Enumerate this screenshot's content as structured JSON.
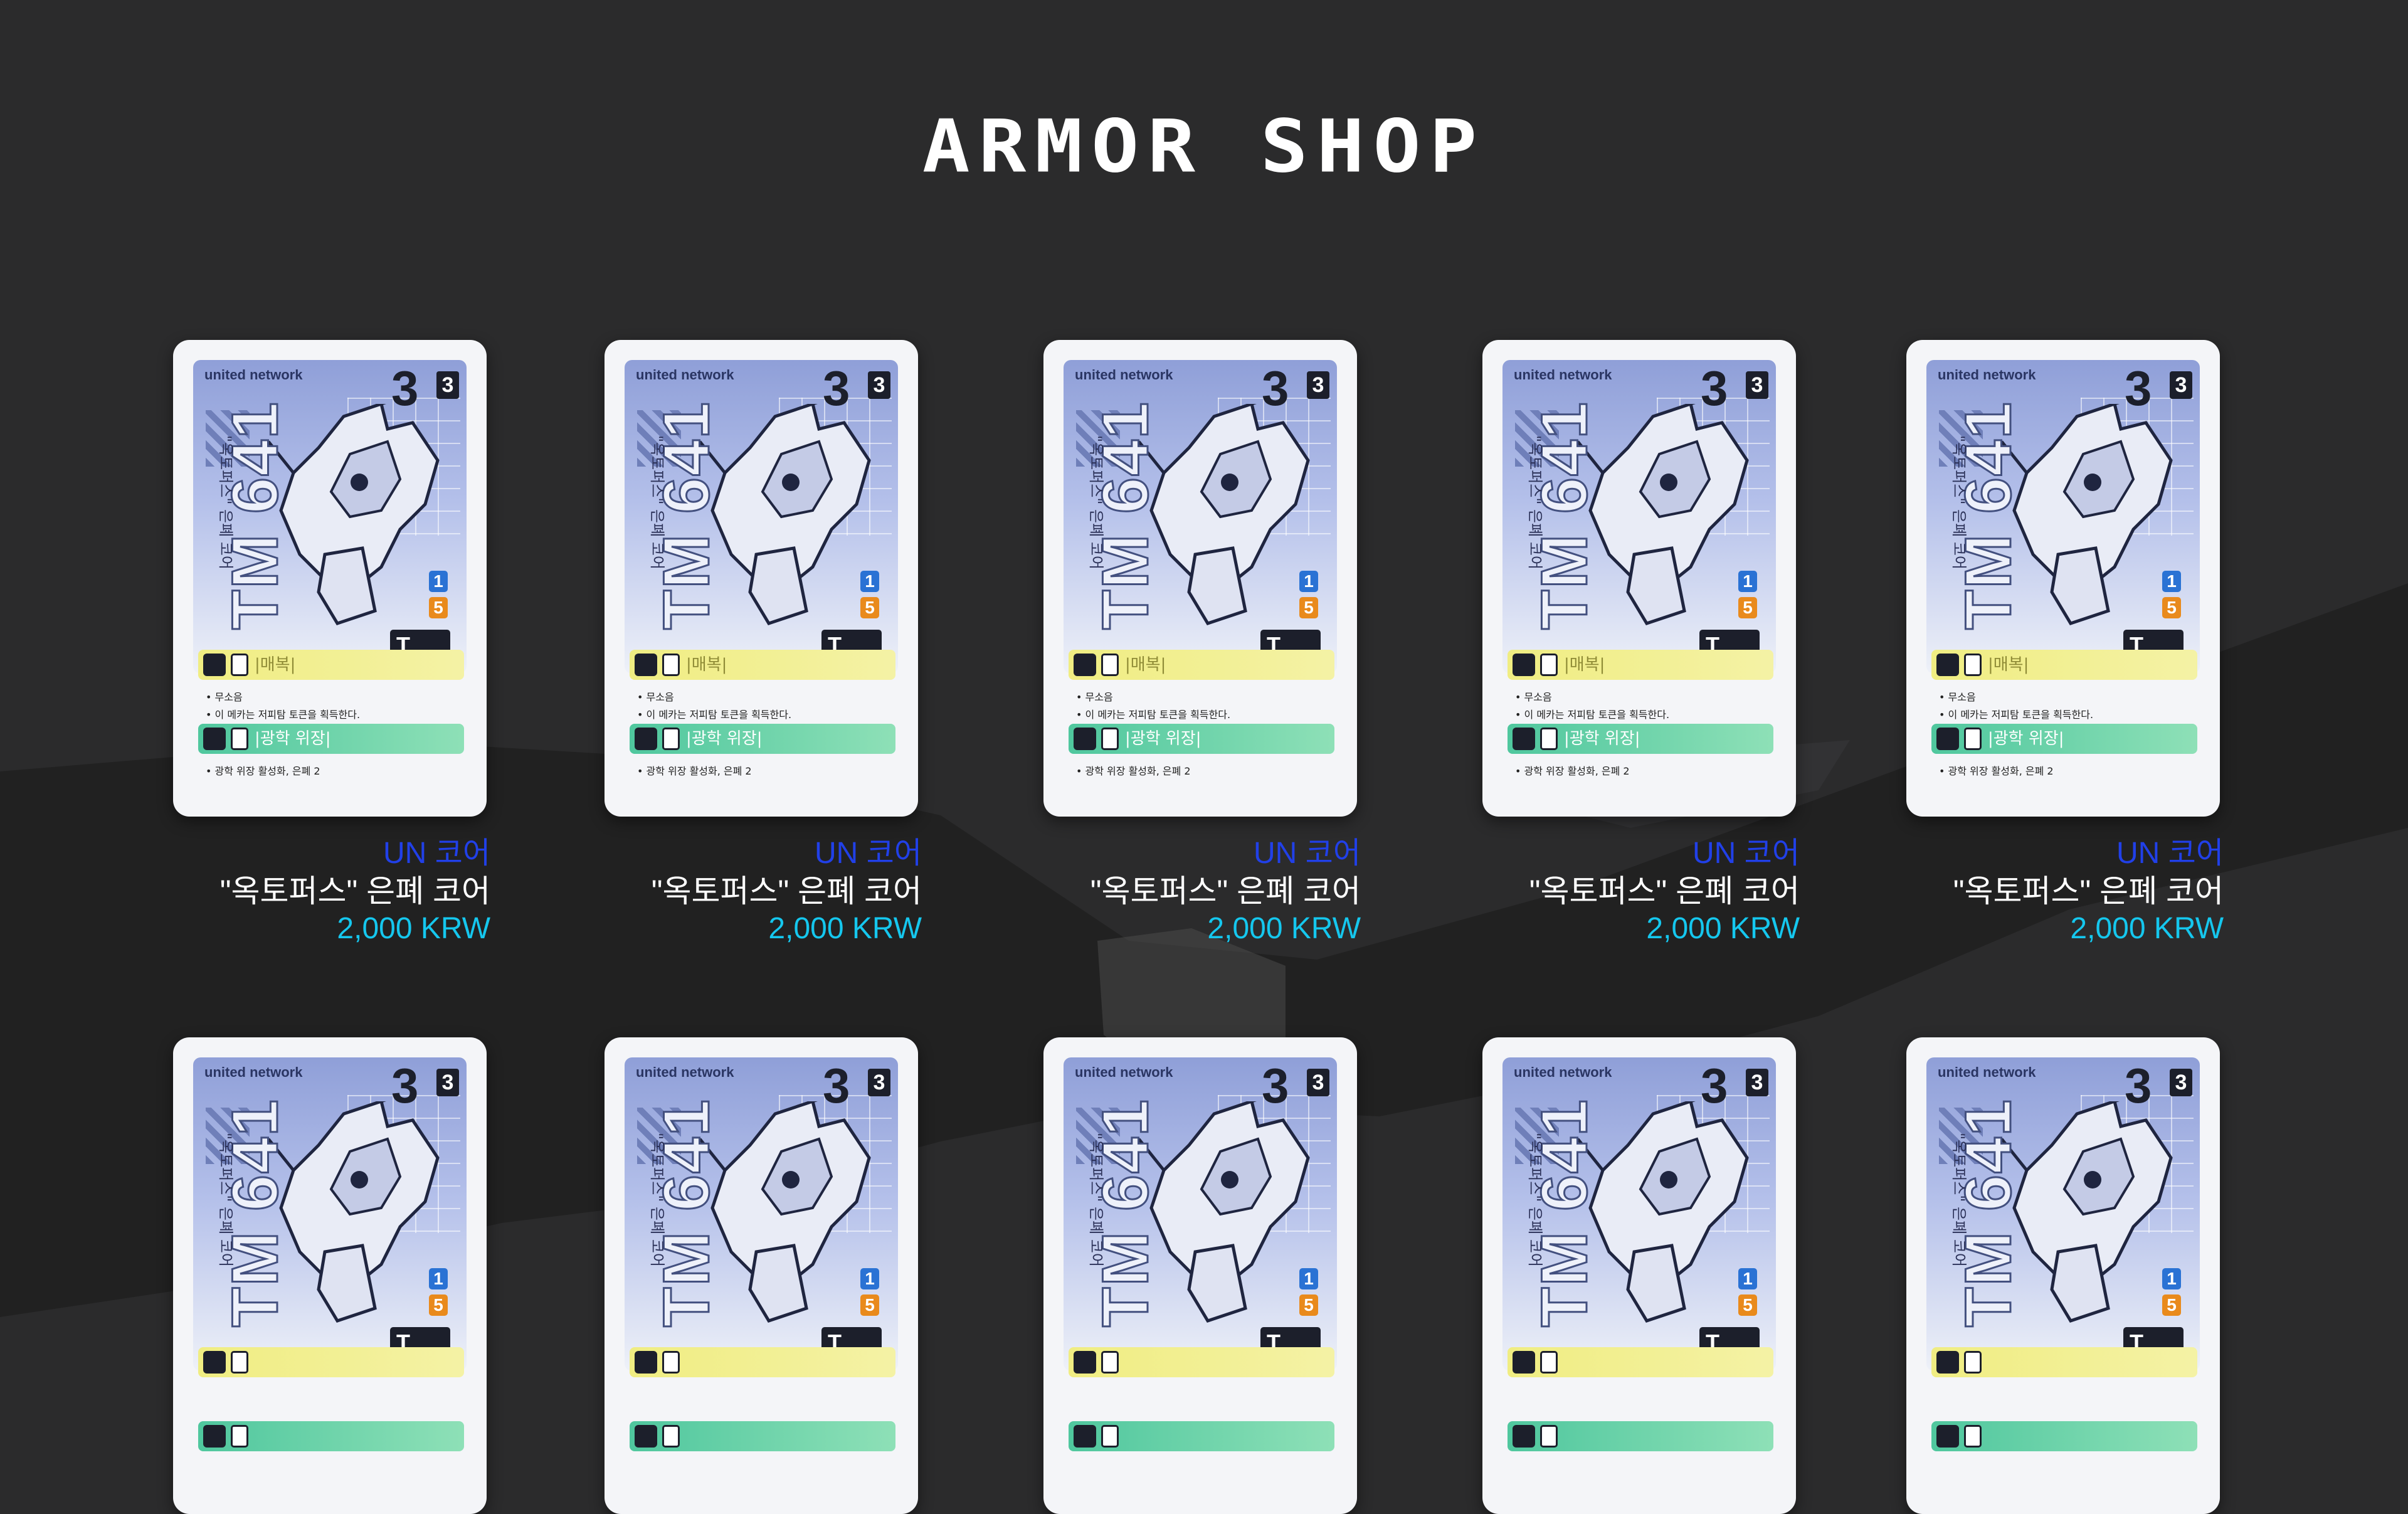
{
  "page": {
    "title": "ARMOR SHOP",
    "background_color": "#2b2b2c",
    "title_color": "#ffffff"
  },
  "colors": {
    "brand": "#2140e8",
    "name": "#ffffff",
    "price": "#15c7ee"
  },
  "products": [
    {
      "brand": "UN 코어",
      "name": "\"옥토퍼스\" 은폐 코어",
      "price": "2,000 KRW",
      "card": {
        "logo": "united network",
        "cost": "3",
        "cost_box": "3",
        "code": "TM 641",
        "vertical_name": "\"옥토퍼스\" 은폐 코어",
        "stat_blue": "1",
        "stat_orange": "5",
        "type_icon": "T",
        "ability1": "|매복|",
        "line1": "• 무소음",
        "line2": "• 이 메카는 저피탐 토큰을 획득한다.",
        "ability2": "|광학 위장|",
        "line3": "• 광학 위장 활성화, 은폐 2"
      }
    },
    {
      "brand": "UN 코어",
      "name": "\"옥토퍼스\" 은폐 코어",
      "price": "2,000 KRW",
      "card": {
        "logo": "united network",
        "cost": "3",
        "cost_box": "3",
        "code": "TM 641",
        "vertical_name": "\"옥토퍼스\" 은폐 코어",
        "stat_blue": "1",
        "stat_orange": "5",
        "type_icon": "T",
        "ability1": "|매복|",
        "line1": "• 무소음",
        "line2": "• 이 메카는 저피탐 토큰을 획득한다.",
        "ability2": "|광학 위장|",
        "line3": "• 광학 위장 활성화, 은폐 2"
      }
    },
    {
      "brand": "UN 코어",
      "name": "\"옥토퍼스\" 은폐 코어",
      "price": "2,000 KRW",
      "card": {
        "logo": "united network",
        "cost": "3",
        "cost_box": "3",
        "code": "TM 641",
        "vertical_name": "\"옥토퍼스\" 은폐 코어",
        "stat_blue": "1",
        "stat_orange": "5",
        "type_icon": "T",
        "ability1": "|매복|",
        "line1": "• 무소음",
        "line2": "• 이 메카는 저피탐 토큰을 획득한다.",
        "ability2": "|광학 위장|",
        "line3": "• 광학 위장 활성화, 은폐 2"
      }
    },
    {
      "brand": "UN 코어",
      "name": "\"옥토퍼스\" 은폐 코어",
      "price": "2,000 KRW",
      "card": {
        "logo": "united network",
        "cost": "3",
        "cost_box": "3",
        "code": "TM 641",
        "vertical_name": "\"옥토퍼스\" 은폐 코어",
        "stat_blue": "1",
        "stat_orange": "5",
        "type_icon": "T",
        "ability1": "|매복|",
        "line1": "• 무소음",
        "line2": "• 이 메카는 저피탐 토큰을 획득한다.",
        "ability2": "|광학 위장|",
        "line3": "• 광학 위장 활성화, 은폐 2"
      }
    },
    {
      "brand": "UN 코어",
      "name": "\"옥토퍼스\" 은폐 코어",
      "price": "2,000 KRW",
      "card": {
        "logo": "united network",
        "cost": "3",
        "cost_box": "3",
        "code": "TM 641",
        "vertical_name": "\"옥토퍼스\" 은폐 코어",
        "stat_blue": "1",
        "stat_orange": "5",
        "type_icon": "T",
        "ability1": "|매복|",
        "line1": "• 무소음",
        "line2": "• 이 메카는 저피탐 토큰을 획득한다.",
        "ability2": "|광학 위장|",
        "line3": "• 광학 위장 활성화, 은폐 2"
      }
    },
    {
      "brand": "",
      "name": "",
      "price": "",
      "card": {
        "logo": "united network",
        "cost": "3",
        "cost_box": "3",
        "code": "TM 641",
        "vertical_name": "\"옥토퍼스\" 은폐 코어",
        "stat_blue": "1",
        "stat_orange": "5",
        "type_icon": "T",
        "ability1": "",
        "line1": "",
        "line2": "",
        "ability2": "",
        "line3": ""
      }
    },
    {
      "brand": "",
      "name": "",
      "price": "",
      "card": {
        "logo": "united network",
        "cost": "3",
        "cost_box": "3",
        "code": "TM 641",
        "vertical_name": "\"옥토퍼스\" 은폐 코어",
        "stat_blue": "1",
        "stat_orange": "5",
        "type_icon": "T",
        "ability1": "",
        "line1": "",
        "line2": "",
        "ability2": "",
        "line3": ""
      }
    },
    {
      "brand": "",
      "name": "",
      "price": "",
      "card": {
        "logo": "united network",
        "cost": "3",
        "cost_box": "3",
        "code": "TM 641",
        "vertical_name": "\"옥토퍼스\" 은폐 코어",
        "stat_blue": "1",
        "stat_orange": "5",
        "type_icon": "T",
        "ability1": "",
        "line1": "",
        "line2": "",
        "ability2": "",
        "line3": ""
      }
    },
    {
      "brand": "",
      "name": "",
      "price": "",
      "card": {
        "logo": "united network",
        "cost": "3",
        "cost_box": "3",
        "code": "TM 641",
        "vertical_name": "\"옥토퍼스\" 은폐 코어",
        "stat_blue": "1",
        "stat_orange": "5",
        "type_icon": "T",
        "ability1": "",
        "line1": "",
        "line2": "",
        "ability2": "",
        "line3": ""
      }
    },
    {
      "brand": "",
      "name": "",
      "price": "",
      "card": {
        "logo": "united network",
        "cost": "3",
        "cost_box": "3",
        "code": "TM 641",
        "vertical_name": "\"옥토퍼스\" 은폐 코어",
        "stat_blue": "1",
        "stat_orange": "5",
        "type_icon": "T",
        "ability1": "",
        "line1": "",
        "line2": "",
        "ability2": "",
        "line3": ""
      }
    }
  ]
}
